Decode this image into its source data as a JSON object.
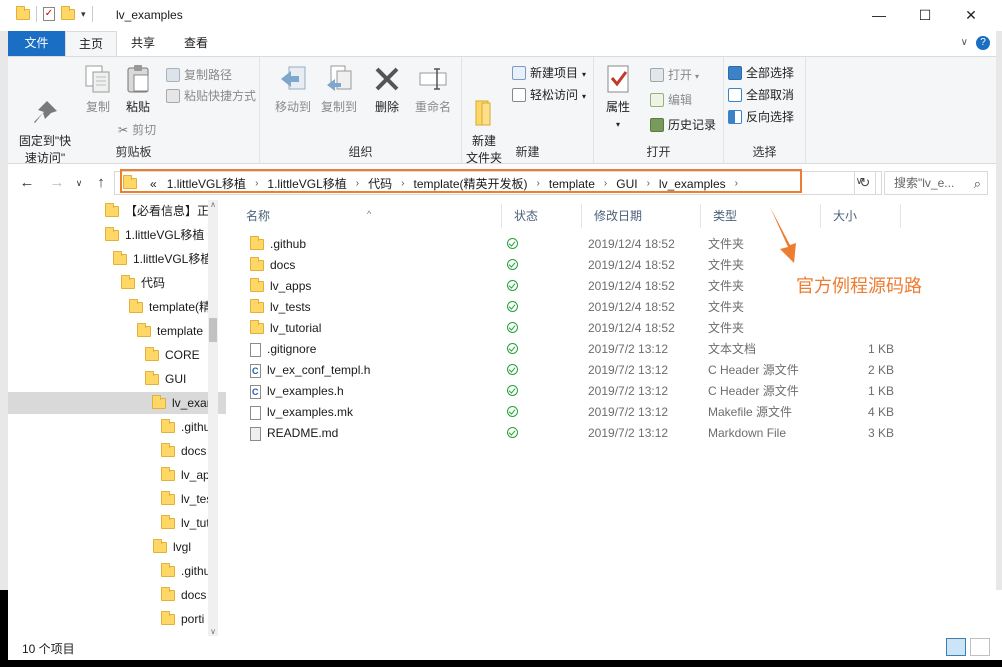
{
  "window": {
    "title": "lv_examples",
    "minimize": "—",
    "maximize": "☐",
    "close": "✕"
  },
  "tabs": [
    "文件",
    "主页",
    "共享",
    "查看"
  ],
  "ribbon": {
    "clipboard": {
      "pin": "固定到\"快\n速访问\"",
      "copy": "复制",
      "paste": "粘贴",
      "copy_path": "复制路径",
      "paste_shortcut": "粘贴快捷方式",
      "cut": "剪切",
      "label": "剪贴板"
    },
    "organize": {
      "move_to": "移动到",
      "copy_to": "复制到",
      "delete": "删除",
      "rename": "重命名",
      "label": "组织"
    },
    "new": {
      "new_folder": "新建\n文件夹",
      "new_item": "新建项目",
      "easy_access": "轻松访问",
      "label": "新建"
    },
    "open": {
      "properties": "属性",
      "open": "打开",
      "edit": "编辑",
      "history": "历史记录",
      "label": "打开"
    },
    "select": {
      "select_all": "全部选择",
      "select_none": "全部取消",
      "invert": "反向选择",
      "label": "选择"
    }
  },
  "address": {
    "crumbs": [
      "«",
      "1.littleVGL移植",
      "1.littleVGL移植",
      "代码",
      "template(精英开发板)",
      "template",
      "GUI",
      "lv_examples"
    ],
    "search_placeholder": "搜索\"lv_e..."
  },
  "nav_tree": [
    {
      "label": "【必看信息】正",
      "indent": 0
    },
    {
      "label": "1.littleVGL移植",
      "indent": 0
    },
    {
      "label": "1.littleVGL移植",
      "indent": 1
    },
    {
      "label": "代码",
      "indent": 2
    },
    {
      "label": "template(精",
      "indent": 3
    },
    {
      "label": "template",
      "indent": 4
    },
    {
      "label": "CORE",
      "indent": 5
    },
    {
      "label": "GUI",
      "indent": 5
    },
    {
      "label": "lv_exam",
      "indent": 6,
      "selected": true
    },
    {
      "label": ".githu",
      "indent": 7
    },
    {
      "label": "docs",
      "indent": 7
    },
    {
      "label": "lv_ap",
      "indent": 7
    },
    {
      "label": "lv_tes",
      "indent": 7
    },
    {
      "label": "lv_tut",
      "indent": 7
    },
    {
      "label": "lvgl",
      "indent": 6
    },
    {
      "label": ".githu",
      "indent": 7
    },
    {
      "label": "docs",
      "indent": 7
    },
    {
      "label": "porti",
      "indent": 7
    }
  ],
  "columns": [
    "名称",
    "状态",
    "修改日期",
    "类型",
    "大小"
  ],
  "files": [
    {
      "name": ".github",
      "kind": "folder",
      "date": "2019/12/4 18:52",
      "type": "文件夹",
      "size": ""
    },
    {
      "name": "docs",
      "kind": "folder",
      "date": "2019/12/4 18:52",
      "type": "文件夹",
      "size": ""
    },
    {
      "name": "lv_apps",
      "kind": "folder",
      "date": "2019/12/4 18:52",
      "type": "文件夹",
      "size": ""
    },
    {
      "name": "lv_tests",
      "kind": "folder",
      "date": "2019/12/4 18:52",
      "type": "文件夹",
      "size": ""
    },
    {
      "name": "lv_tutorial",
      "kind": "folder",
      "date": "2019/12/4 18:52",
      "type": "文件夹",
      "size": ""
    },
    {
      "name": ".gitignore",
      "kind": "file",
      "date": "2019/7/2 13:12",
      "type": "文本文档",
      "size": "1 KB"
    },
    {
      "name": "lv_ex_conf_templ.h",
      "kind": "h",
      "date": "2019/7/2 13:12",
      "type": "C Header 源文件",
      "size": "2 KB"
    },
    {
      "name": "lv_examples.h",
      "kind": "h",
      "date": "2019/7/2 13:12",
      "type": "C Header 源文件",
      "size": "1 KB"
    },
    {
      "name": "lv_examples.mk",
      "kind": "file",
      "date": "2019/7/2 13:12",
      "type": "Makefile 源文件",
      "size": "4 KB"
    },
    {
      "name": "README.md",
      "kind": "md",
      "date": "2019/7/2 13:12",
      "type": "Markdown File",
      "size": "3 KB"
    }
  ],
  "annotation": "官方例程源码路",
  "status": {
    "count": "10 个项目"
  },
  "colors": {
    "accent": "#1a6fc4",
    "highlight": "#ed7d31",
    "ok": "#22a336"
  }
}
